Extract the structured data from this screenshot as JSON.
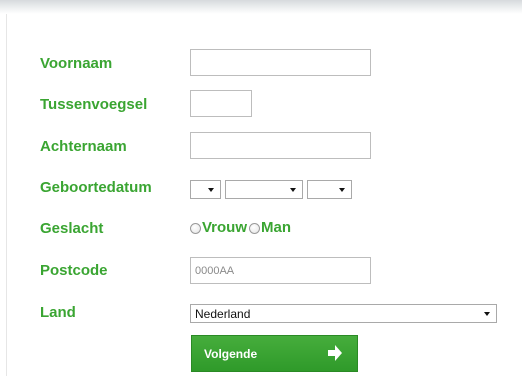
{
  "form": {
    "fields": {
      "voornaam": {
        "label": "Voornaam",
        "value": ""
      },
      "tussenvoegsel": {
        "label": "Tussenvoegsel",
        "value": ""
      },
      "achternaam": {
        "label": "Achternaam",
        "value": ""
      },
      "geboortedatum": {
        "label": "Geboortedatum",
        "day": "",
        "month": "",
        "year": ""
      },
      "geslacht": {
        "label": "Geslacht",
        "options": [
          "Vrouw",
          "Man"
        ],
        "selected": ""
      },
      "postcode": {
        "label": "Postcode",
        "placeholder": "0000AA",
        "value": ""
      },
      "land": {
        "label": "Land",
        "selected": "Nederland"
      }
    },
    "submit_label": "Volgende"
  },
  "colors": {
    "label_green": "#3aa532",
    "button_green": "#2f9a2a",
    "input_border": "#bdbdbd"
  },
  "icons": {
    "button_icon": "arrow-right-icon",
    "select_icon": "chevron-down-icon",
    "radio_icon": "radio-button-icon"
  }
}
